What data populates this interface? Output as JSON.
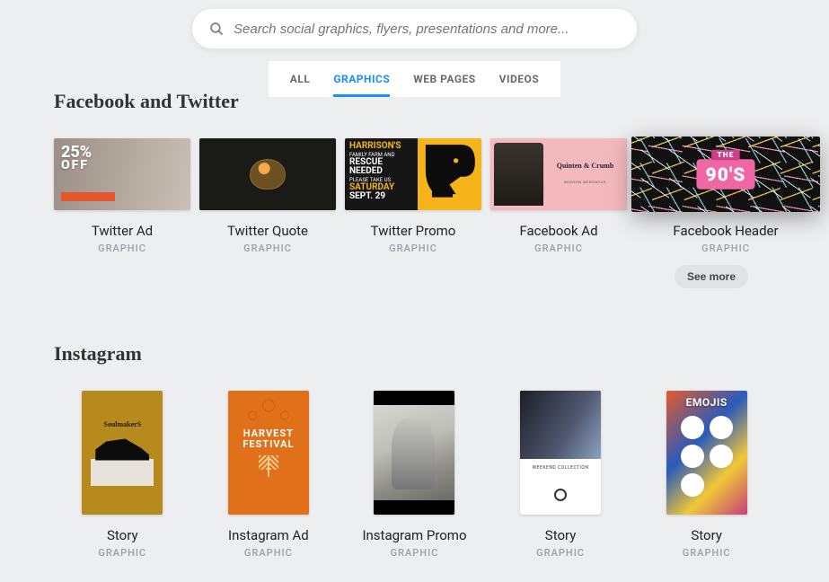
{
  "search": {
    "placeholder": "Search social graphics, flyers, presentations and more..."
  },
  "tabs": [
    {
      "label": "ALL",
      "active": false
    },
    {
      "label": "GRAPHICS",
      "active": true
    },
    {
      "label": "WEB PAGES",
      "active": false
    },
    {
      "label": "VIDEOS",
      "active": false
    }
  ],
  "see_more_label": "See more",
  "sections": [
    {
      "title": "Facebook and Twitter",
      "items": [
        {
          "title": "Twitter Ad",
          "subtitle": "GRAPHIC",
          "art": "t-ad",
          "shape": "landscape",
          "hover": false,
          "overlay": {
            "big": "25%",
            "small": "OFF"
          }
        },
        {
          "title": "Twitter Quote",
          "subtitle": "GRAPHIC",
          "art": "t-quote",
          "shape": "landscape",
          "hover": false,
          "overlay": {}
        },
        {
          "title": "Twitter Promo",
          "subtitle": "GRAPHIC",
          "art": "t-promo",
          "shape": "landscape",
          "hover": false,
          "overlay": {
            "line1": "HARRISON'S",
            "line2": "FAMILY FARM AND",
            "line3": "RESCUE NEEDED",
            "line4": "PLEASE TAKE US",
            "line5": "SATURDAY",
            "line6": "SEPT. 29"
          }
        },
        {
          "title": "Facebook Ad",
          "subtitle": "GRAPHIC",
          "art": "fb-ad",
          "shape": "landscape",
          "hover": false,
          "overlay": {
            "brand": "Quinten & Crumb",
            "tag": "MODERN MENSWEAR"
          }
        },
        {
          "title": "Facebook Header",
          "subtitle": "GRAPHIC",
          "art": "fb-header",
          "shape": "landscape wide",
          "hover": true,
          "overlay": {
            "badge": "90'S",
            "ribbon": "THE"
          }
        }
      ]
    },
    {
      "title": "Instagram",
      "items": [
        {
          "title": "Story",
          "subtitle": "GRAPHIC",
          "art": "ig-soul",
          "shape": "portrait",
          "hover": false,
          "overlay": {
            "brand": "SoulmakerS"
          }
        },
        {
          "title": "Instagram Ad",
          "subtitle": "GRAPHIC",
          "art": "ig-harvest",
          "shape": "portrait",
          "hover": false,
          "overlay": {
            "line1": "HARVEST",
            "line2": "FESTIVAL"
          }
        },
        {
          "title": "Instagram Promo",
          "subtitle": "GRAPHIC",
          "art": "ig-promo",
          "shape": "portrait",
          "hover": false,
          "overlay": {}
        },
        {
          "title": "Story",
          "subtitle": "GRAPHIC",
          "art": "ig-collage",
          "shape": "portrait",
          "hover": false,
          "overlay": {
            "tape": "WEEKEND COLLECTION"
          }
        },
        {
          "title": "Story",
          "subtitle": "GRAPHIC",
          "art": "ig-emoji",
          "shape": "portrait",
          "hover": false,
          "overlay": {
            "heading": "EMOJIS"
          }
        }
      ]
    }
  ]
}
